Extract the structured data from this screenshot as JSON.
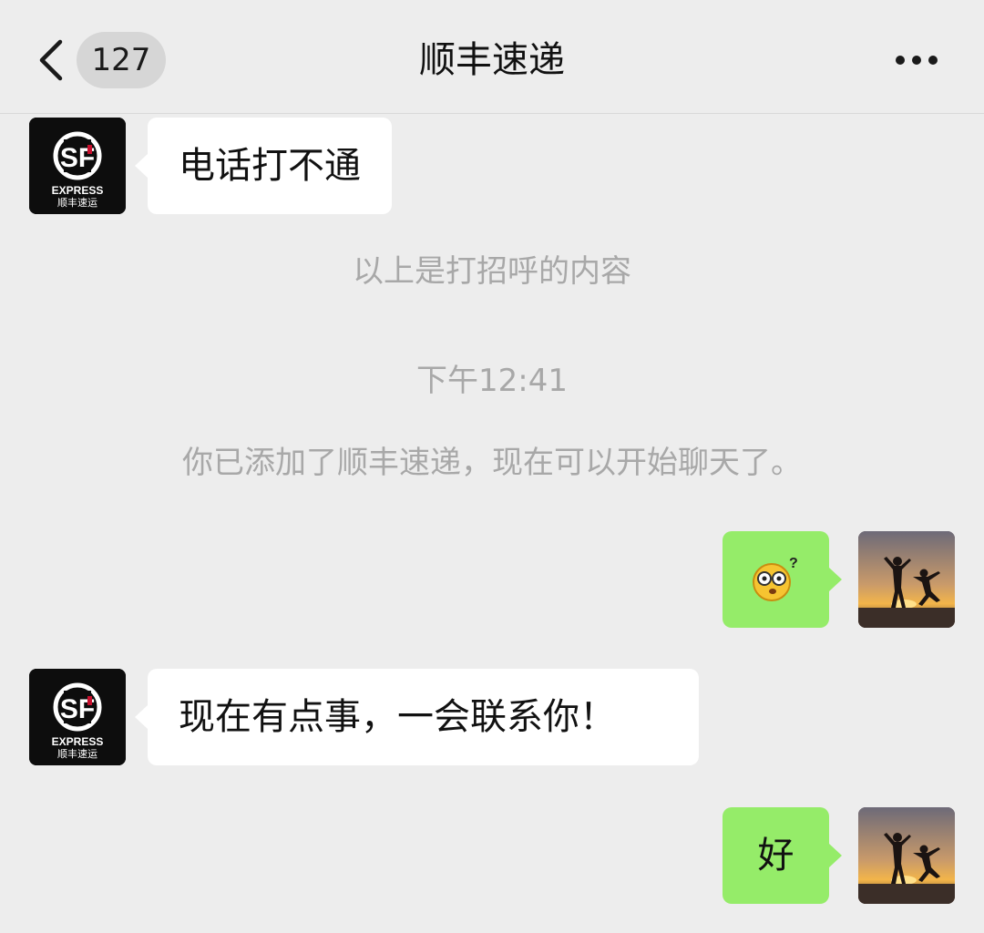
{
  "header": {
    "unread_count": "127",
    "title": "顺丰速递"
  },
  "sf_logo": {
    "express_text": "EXPRESS",
    "cn_text": "顺丰速运"
  },
  "messages": [
    {
      "from": "contact",
      "text": "电话打不通"
    },
    {
      "from": "self",
      "text": "",
      "sticker": "confused-emoji-sticker"
    },
    {
      "from": "contact",
      "text": "现在有点事，一会联系你！"
    },
    {
      "from": "self",
      "text": "好"
    }
  ],
  "system": {
    "greeting_note": "以上是打招呼的内容",
    "timestamp": "下午12:41",
    "added_notice": "你已添加了顺丰速递，现在可以开始聊天了。"
  },
  "colors": {
    "background": "#ededed",
    "incoming_bubble": "#ffffff",
    "outgoing_bubble": "#95ec69",
    "system_text": "#a8a8a8",
    "sf_logo_accent": "#c8102e"
  }
}
